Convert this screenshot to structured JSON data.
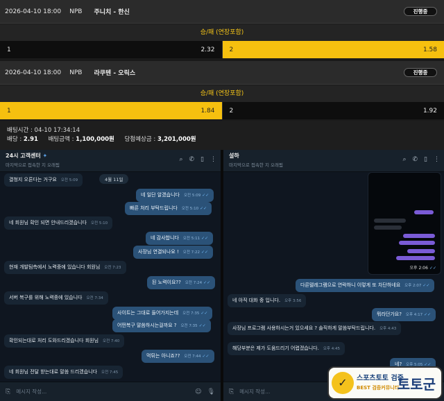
{
  "matches": [
    {
      "date": "2026-04-10 18:00",
      "league": "NPB",
      "teams": "주니치 - 한신",
      "status": "진행중",
      "market": "승/패 (연장포함)",
      "opt1": {
        "label": "1",
        "odd": "2.32"
      },
      "opt2": {
        "label": "2",
        "odd": "1.58"
      }
    },
    {
      "date": "2026-04-10 18:00",
      "league": "NPB",
      "teams": "라쿠텐 - 오릭스",
      "status": "진행중",
      "market": "승/패 (연장포함)",
      "opt1": {
        "label": "1",
        "odd": "1.84"
      },
      "opt2": {
        "label": "2",
        "odd": "1.92"
      }
    }
  ],
  "bet": {
    "time_label": "배팅시간 : 04-10 17:34:14",
    "odds_label": "배당 :",
    "odds_value": "2.91",
    "amount_label": "배팅금액 :",
    "amount_value": "1,100,000원",
    "payout_label": "당첨예상금 :",
    "payout_value": "3,201,000원"
  },
  "left_chat": {
    "name": "24시 고객센터",
    "subtitle": "마지막으로 접속한 지 오래됨",
    "day": "4월 11일",
    "input_placeholder": "메시지 작성...",
    "messages": [
      {
        "text": "결청지 오른다는 거구요",
        "time": "오전 5:09",
        "dir": "in"
      },
      {
        "text": "네 일단 알겠습니다",
        "time": "오전 5:09",
        "dir": "out"
      },
      {
        "text": "빠른 처리 부탁드립니다",
        "time": "오전 5:10",
        "dir": "out"
      },
      {
        "text": "네 회원님 확인 되면 안내드리겠습니다",
        "time": "오전 5:10",
        "dir": "in"
      },
      {
        "text": "네 감사합니다",
        "time": "오전 5:11",
        "dir": "out"
      },
      {
        "text": "사장님 연결되나요 !",
        "time": "오전 7:22",
        "dir": "out"
      },
      {
        "text": "현재 개발팀측에서 노력중에 있습니다 회원님",
        "time": "오전 7:23",
        "dir": "in"
      },
      {
        "text": "된 노력이요??",
        "time": "오전 7:24",
        "dir": "out"
      },
      {
        "text": "서버 복구를 위해 노력중에 있습니다",
        "time": "오전 7:34",
        "dir": "in"
      },
      {
        "text": "사이트는 그대로 들어가지는데",
        "time": "오전 7:35",
        "dir": "out"
      },
      {
        "text": "어떤복구 말씀하시는걸까요 ?",
        "time": "오전 7:35",
        "dir": "out"
      },
      {
        "text": "확인되는대로 처리 도와드리겠습니다 회원님",
        "time": "오전 7:40",
        "dir": "in"
      },
      {
        "text": "먹튀는 아니죠??",
        "time": "오전 7:44",
        "dir": "out"
      },
      {
        "text": "네 회원님 전달 받는대로 말씀 드리겠습니다",
        "time": "오전 7:45",
        "dir": "in"
      }
    ]
  },
  "right_chat": {
    "name": "설하",
    "subtitle": "마지막으로 접속한 지 오래됨",
    "input_placeholder": "메시지 작성...",
    "screenshot_time": "오후 2:06",
    "messages": [
      {
        "text": "다른텔레그램으로 연락하니 이렇게 또 차단하네요",
        "time": "오후 2:07",
        "dir": "out"
      },
      {
        "text": "네 아직 대화 중 입니다.",
        "time": "오후 3:56",
        "dir": "in"
      },
      {
        "text": "뭐라던가요?",
        "time": "오후 4:17",
        "dir": "out"
      },
      {
        "text": "사장님 프로그램 사용하시는거 있으세요 ? 솔직하게 말씀부탁드립니다.",
        "time": "오후 4:43",
        "dir": "in"
      },
      {
        "text": "해당부분은 제가 도움드리기 어렵겠습니다.",
        "time": "오후 4:45",
        "dir": "in"
      },
      {
        "text": "네?",
        "time": "오후 5:05",
        "dir": "out"
      }
    ]
  },
  "logo": {
    "line1": "스포츠토토 검증",
    "line2": "BEST 검증커뮤니티",
    "brand": "토토군"
  }
}
